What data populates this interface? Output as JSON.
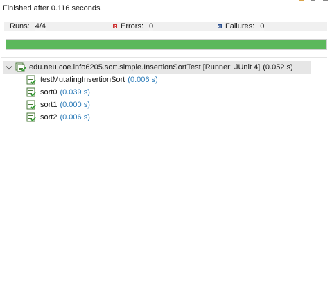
{
  "status": {
    "finished_text": "Finished after 0.116 seconds"
  },
  "counters": {
    "runs_label": "Runs:",
    "runs_value": "4/4",
    "errors_label": "Errors:",
    "errors_value": "0",
    "failures_label": "Failures:",
    "failures_value": "0"
  },
  "progress": {
    "fraction": 1.0,
    "color": "#5cb85c"
  },
  "tree": {
    "root": {
      "name": "edu.neu.coe.info6205.sort.simple.InsertionSortTest [Runner: JUnit 4]",
      "time": "(0.052 s)",
      "icon": "test-suite-passed-icon",
      "expanded": true
    },
    "children": [
      {
        "name": "testMutatingInsertionSort",
        "time": "(0.006 s)",
        "icon": "test-passed-icon"
      },
      {
        "name": "sort0",
        "time": "(0.039 s)",
        "icon": "test-passed-icon"
      },
      {
        "name": "sort1",
        "time": "(0.000 s)",
        "icon": "test-passed-icon"
      },
      {
        "name": "sort2",
        "time": "(0.006 s)",
        "icon": "test-passed-icon"
      }
    ]
  },
  "colors": {
    "time_text": "#2a7ab8",
    "selection_bg": "#e6e6e6",
    "pass_green": "#5cb85c"
  }
}
